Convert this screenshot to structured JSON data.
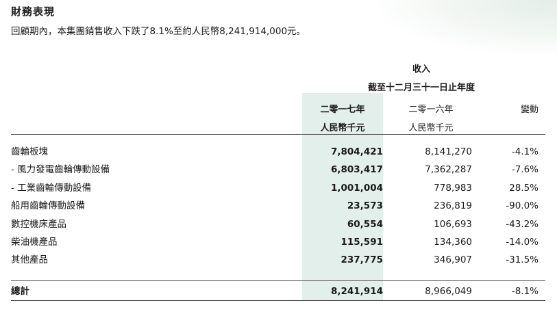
{
  "page": {
    "title": "財務表現",
    "intro": "回顧期內，本集團銷售收入下跌了8.1%至約人民幣8,241,914,000元。"
  },
  "table": {
    "header_revenue": "收入",
    "header_period": "截至十二月三十一日止年度",
    "col_2017_year": "二零一七年",
    "col_2017_unit": "人民幣千元",
    "col_2016_year": "二零一六年",
    "col_2016_unit": "人民幣千元",
    "col_change": "變動",
    "rows": [
      {
        "label": "齒輪板塊",
        "v2017": "7,804,421",
        "v2016": "8,141,270",
        "change": "-4.1%"
      },
      {
        "label": "- 風力發電齒輪傳動設備",
        "v2017": "6,803,417",
        "v2016": "7,362,287",
        "change": "-7.6%"
      },
      {
        "label": "- 工業齒輪傳動設備",
        "v2017": "1,001,004",
        "v2016": "778,983",
        "change": "28.5%"
      },
      {
        "label": "船用齒輪傳動設備",
        "v2017": "23,573",
        "v2016": "236,819",
        "change": "-90.0%"
      },
      {
        "label": "數控機床產品",
        "v2017": "60,554",
        "v2016": "106,693",
        "change": "-43.2%"
      },
      {
        "label": "柴油機產品",
        "v2017": "115,591",
        "v2016": "134,360",
        "change": "-14.0%"
      },
      {
        "label": "其他產品",
        "v2017": "237,775",
        "v2016": "346,907",
        "change": "-31.5%"
      }
    ],
    "total": {
      "label": "總計",
      "v2017": "8,241,914",
      "v2016": "8,966,049",
      "change": "-8.1%"
    }
  },
  "colors": {
    "highlight_column": "#e3efea",
    "rule": "#555555",
    "text": "#1a1a1a"
  }
}
